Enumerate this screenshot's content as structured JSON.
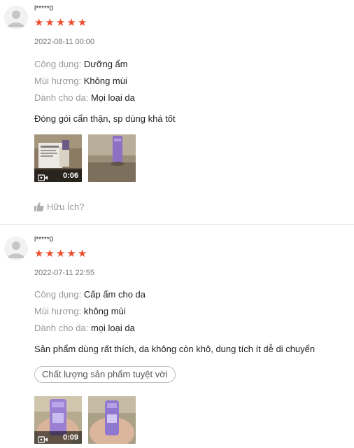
{
  "reviews": [
    {
      "username": "l*****0",
      "rating": 5,
      "date": "2022-08-11 00:00",
      "attributes": [
        {
          "label": "Công dụng:",
          "value": "Dưỡng ẩm"
        },
        {
          "label": "Mùi hương:",
          "value": "Không mùi"
        },
        {
          "label": "Dành cho da:",
          "value": "Mọi loại da"
        }
      ],
      "comment": "Đóng gói cẩn thận, sp dùng khá tốt",
      "media": [
        {
          "type": "video",
          "duration": "0:06"
        },
        {
          "type": "image"
        }
      ],
      "helpful_label": "Hữu Ích?"
    },
    {
      "username": "l*****0",
      "rating": 5,
      "date": "2022-07-11 22:55",
      "attributes": [
        {
          "label": "Công dụng:",
          "value": "Cấp ẩm cho da"
        },
        {
          "label": "Mùi hương:",
          "value": "không mùi"
        },
        {
          "label": "Dành cho da:",
          "value": "mọi loại da"
        }
      ],
      "comment": "Sản phẩm dùng rất thích, da không còn khô, dung tích ít dễ di chuyển",
      "tag": "Chất lượng sản phẩm tuyệt vời",
      "media": [
        {
          "type": "video",
          "duration": "0:09"
        },
        {
          "type": "image"
        }
      ]
    }
  ],
  "icons": {
    "avatar": "user-avatar-icon",
    "star": "star-icon",
    "video": "video-camera-icon",
    "helpful": "thumbs-up-icon"
  },
  "colors": {
    "star": "#ee4d2d",
    "label": "#9a9a9a",
    "text": "#222222"
  }
}
